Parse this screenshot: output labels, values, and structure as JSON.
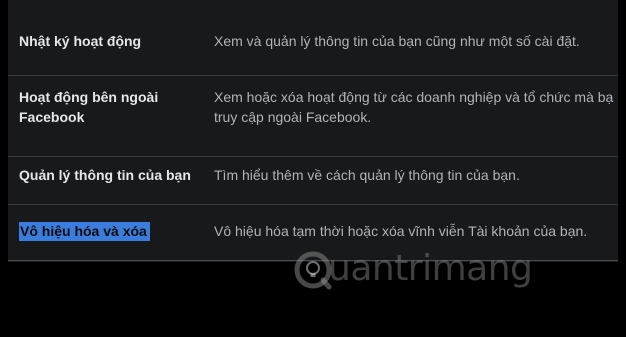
{
  "settings": {
    "rows": [
      {
        "label": "Nhật ký hoạt động",
        "description": "Xem và quản lý thông tin của bạn cũng như một số cài đặt."
      },
      {
        "label_line1": "Hoạt động bên ngoài",
        "label_line2": "Facebook",
        "description_line1": "Xem hoặc xóa hoạt động từ các doanh nghiệp và tổ chức mà bạ",
        "description_line2": "truy cập ngoài Facebook."
      },
      {
        "label": "Quản lý thông tin của bạn",
        "description": "Tìm hiểu thêm về cách quản lý thông tin của bạn."
      },
      {
        "label": "Vô hiệu hóa và xóa",
        "description": "Vô hiệu hóa tạm thời hoặc xóa vĩnh viễn Tài khoản của bạn."
      }
    ]
  },
  "watermark": {
    "text": "uantrimang",
    "icon": "quantrimang-logo-icon"
  },
  "colors": {
    "background": "#000000",
    "panel": "#18191a",
    "label_text": "#e4e6eb",
    "description_text": "#b0b3b8",
    "selection_highlight": "#3b7ddd",
    "divider": "#3a3b3c"
  }
}
